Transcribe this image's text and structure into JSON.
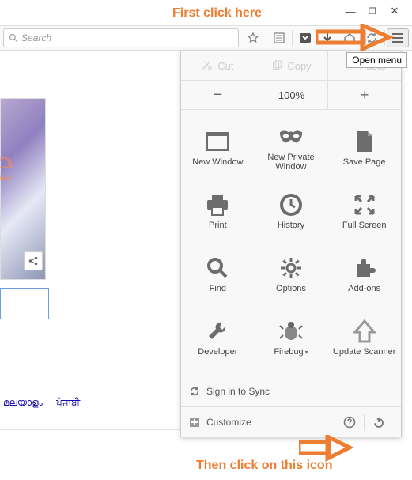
{
  "annotations": {
    "top": "First click here",
    "bottom": "Then click on this icon"
  },
  "window": {
    "min": "—",
    "max": "❐",
    "close": "✕"
  },
  "search": {
    "placeholder": "Search"
  },
  "tooltip": "Open menu",
  "menu": {
    "edit": {
      "cut": "Cut",
      "copy": "Copy",
      "paste": "Paste"
    },
    "zoom": {
      "out": "−",
      "level": "100%",
      "in": "+"
    },
    "items": [
      {
        "label": "New Window"
      },
      {
        "label": "New Private Window"
      },
      {
        "label": "Save Page"
      },
      {
        "label": "Print"
      },
      {
        "label": "History"
      },
      {
        "label": "Full Screen"
      },
      {
        "label": "Find"
      },
      {
        "label": "Options"
      },
      {
        "label": "Add-ons"
      },
      {
        "label": "Developer"
      },
      {
        "label": "Firebug"
      },
      {
        "label": "Update Scanner"
      }
    ],
    "sync": "Sign in to Sync",
    "customize": "Customize"
  },
  "lang": {
    "a": "മലയാളം",
    "b": "ਪੰਜਾਬੀ"
  },
  "colors": {
    "accent": "#ED7D31"
  }
}
